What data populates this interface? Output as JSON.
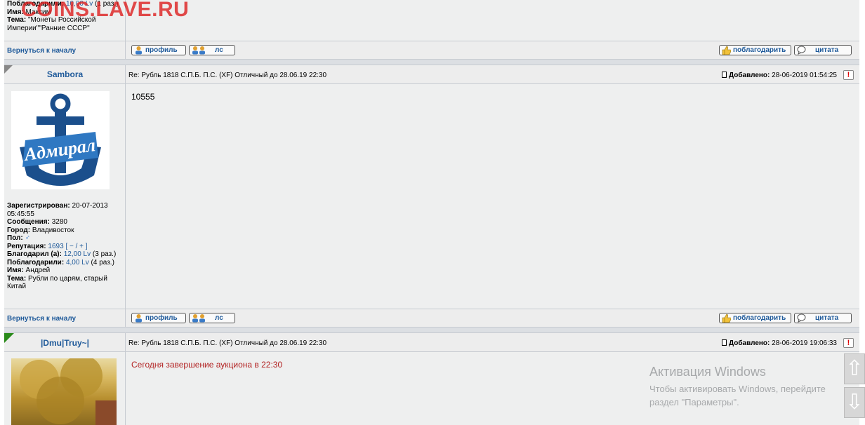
{
  "watermark": "COINS.LAVE.RU",
  "post0": {
    "thanked_label": "Поблагодарили:",
    "thanked_value": "10,00 Lv",
    "thanked_suffix": "(1 раз.)",
    "name_label": "Имя:",
    "name_value": "Максим",
    "topic_label": "Тема:",
    "topic_value": "\"Монеты Российской Империи\"\"Ранние СССР\"",
    "back_to_top": "Вернуться к началу"
  },
  "buttons": {
    "profile": "профиль",
    "pm": "лс",
    "thank": "поблагодарить",
    "quote": "цитата"
  },
  "post1": {
    "username": "Sambora",
    "subject": "Re: Рубль 1818 С.П.Б. П.С. (XF) Отличный до 28.06.19 22:30",
    "added_label": "Добавлено:",
    "added_value": "28-06-2019 01:54:25",
    "body": "10555",
    "avatar_text": "Адмирал",
    "registered_label": "Зарегистрирован:",
    "registered_value": "20-07-2013 05:45:55",
    "messages_label": "Сообщения:",
    "messages_value": "3280",
    "city_label": "Город:",
    "city_value": "Владивосток",
    "sex_label": "Пол:",
    "sex_value": "♂",
    "rep_label": "Репутация:",
    "rep_value": "1693",
    "rep_links": "[ − / + ]",
    "thanked_by_label": "Благодарил (а):",
    "thanked_by_value": "12,00 Lv",
    "thanked_by_suffix": "(3 раз.)",
    "thanked_label": "Поблагодарили:",
    "thanked_value": "4,00 Lv",
    "thanked_suffix": "(4 раз.)",
    "name_label": "Имя:",
    "name_value": "Андрей",
    "topic_label": "Тема:",
    "topic_value": "Рубли по царям, старый Китай",
    "back_to_top": "Вернуться к началу"
  },
  "post2": {
    "username": "|Dmu|Truy~|",
    "subject": "Re: Рубль 1818 С.П.Б. П.С. (XF) Отличный до 28.06.19 22:30",
    "added_label": "Добавлено:",
    "added_value": "28-06-2019 19:06:33",
    "body": "Сегодня завершение аукциона в 22:30"
  },
  "windows": {
    "title": "Активация Windows",
    "line1": "Чтобы активировать Windows, перейдите",
    "line2": "раздел \"Параметры\"."
  },
  "scroll": {
    "up": "⇧",
    "down": "⇩"
  },
  "warn_icon": "!",
  "colors": {
    "link": "#1f5a9a",
    "body_red": "#b22222",
    "watermark": "#dc1e1e"
  }
}
